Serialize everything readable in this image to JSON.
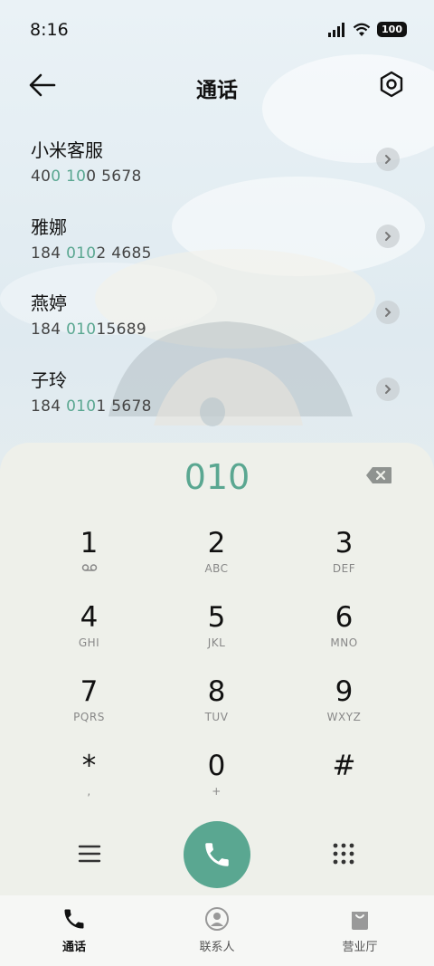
{
  "status_bar": {
    "time": "8:16",
    "battery": "100"
  },
  "header": {
    "title": "通话"
  },
  "results": [
    {
      "name": "小米客服",
      "number_parts": [
        "40",
        "0 10",
        "0 5678"
      ]
    },
    {
      "name": "雅娜",
      "number_parts": [
        "184 ",
        "010",
        "2 4685"
      ]
    },
    {
      "name": "燕婷",
      "number_parts": [
        "184 ",
        "010",
        "15689"
      ]
    },
    {
      "name": "子玲",
      "number_parts": [
        "184 ",
        "010",
        "1 5678"
      ]
    }
  ],
  "dialer": {
    "input": "010",
    "keys": [
      {
        "digit": "1",
        "sub": ""
      },
      {
        "digit": "2",
        "sub": "ABC"
      },
      {
        "digit": "3",
        "sub": "DEF"
      },
      {
        "digit": "4",
        "sub": "GHI"
      },
      {
        "digit": "5",
        "sub": "JKL"
      },
      {
        "digit": "6",
        "sub": "MNO"
      },
      {
        "digit": "7",
        "sub": "PQRS"
      },
      {
        "digit": "8",
        "sub": "TUV"
      },
      {
        "digit": "9",
        "sub": "WXYZ"
      },
      {
        "digit": "*",
        "sub": ","
      },
      {
        "digit": "0",
        "sub": "+"
      },
      {
        "digit": "#",
        "sub": ""
      }
    ]
  },
  "bottom_nav": [
    {
      "label": "通话",
      "icon": "phone-icon",
      "active": true
    },
    {
      "label": "联系人",
      "icon": "contact-icon",
      "active": false
    },
    {
      "label": "营业厅",
      "icon": "shop-bag-icon",
      "active": false
    }
  ],
  "colors": {
    "accent": "#5aa791",
    "dialer_bg": "#eef0ea"
  }
}
